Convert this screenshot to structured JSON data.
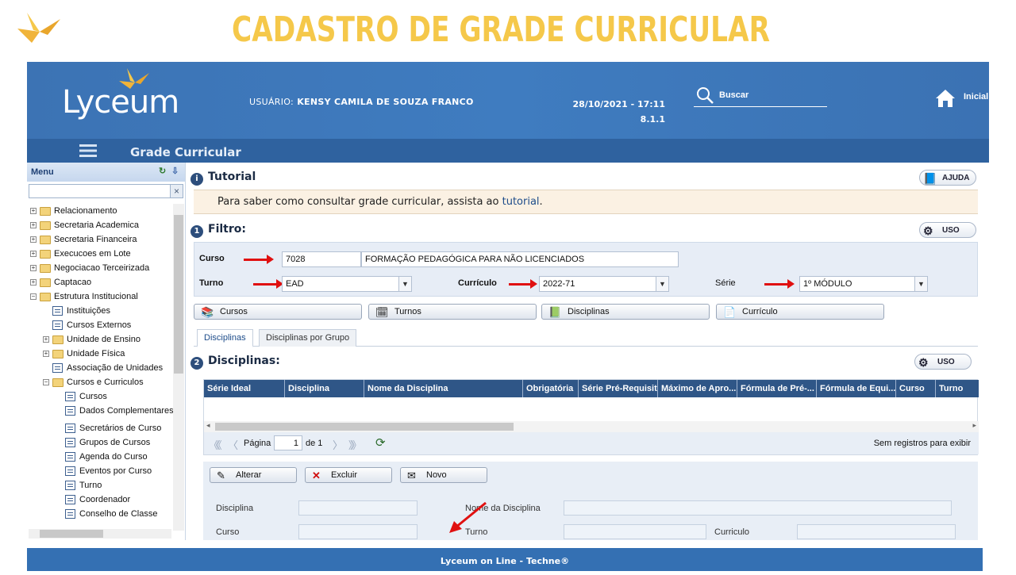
{
  "slide": {
    "title": "CADASTRO DE GRADE CURRICULAR"
  },
  "colors": {
    "title_yellow": "#f5c84a",
    "header_blue": "#3c73b4",
    "grid_header": "#2f5687",
    "arrow_red": "#e01010"
  },
  "header": {
    "logo": "Lyceum",
    "user_label": "USUÁRIO:",
    "user_name": "KENSY CAMILA DE SOUZA FRANCO",
    "datetime": "28/10/2021 - 17:11",
    "version": "8.1.1",
    "search_label": "Buscar",
    "home_label": "Inicial",
    "page_name": "Grade Curricular"
  },
  "sidebar": {
    "menu_label": "Menu",
    "items": [
      {
        "label": "Relacionamento"
      },
      {
        "label": "Secretaria Academica"
      },
      {
        "label": "Secretaria Financeira"
      },
      {
        "label": "Execucoes em Lote"
      },
      {
        "label": "Negociacao Terceirizada"
      },
      {
        "label": "Captacao"
      },
      {
        "label": "Estrutura Institucional"
      },
      {
        "label": "Instituições"
      },
      {
        "label": "Cursos Externos"
      },
      {
        "label": "Unidade de Ensino"
      },
      {
        "label": "Unidade Física"
      },
      {
        "label": "Associação de Unidades"
      },
      {
        "label": "Cursos e Curriculos"
      },
      {
        "label": "Cursos"
      },
      {
        "label": "Dados Complementares"
      },
      {
        "label": "Secretários de Curso"
      },
      {
        "label": "Grupos de Cursos"
      },
      {
        "label": "Agenda do Curso"
      },
      {
        "label": "Eventos por Curso"
      },
      {
        "label": "Turno"
      },
      {
        "label": "Coordenador"
      },
      {
        "label": "Conselho de Classe"
      }
    ]
  },
  "tutorial": {
    "title": "Tutorial",
    "help_label": "AJUDA",
    "text": "Para saber como consultar grade curricular, assista ao",
    "link": "tutorial",
    "end": "."
  },
  "filter": {
    "title": "Filtro:",
    "uso_label": "USO",
    "curso_label": "Curso",
    "curso_code": "7028",
    "curso_name": "FORMAÇÃO PEDAGÓGICA PARA NÃO LICENCIADOS",
    "turno_label": "Turno",
    "turno_value": "EAD",
    "curriculo_label": "Currículo",
    "curriculo_value": "2022-71",
    "serie_label": "Série",
    "serie_value": "1º MÓDULO"
  },
  "buttons": {
    "cursos": "Cursos",
    "turnos": "Turnos",
    "disciplinas": "Disciplinas",
    "curriculo": "Currículo"
  },
  "tabs": [
    {
      "label": "Disciplinas"
    },
    {
      "label": "Disciplinas por Grupo"
    }
  ],
  "disciplinas": {
    "title": "Disciplinas:",
    "uso_label": "USO",
    "columns": [
      "Série Ideal",
      "Disciplina",
      "Nome da Disciplina",
      "Obrigatória",
      "Série Pré-Requisito",
      "Máximo de Apro...",
      "Fórmula de Pré-...",
      "Fórmula de Equi...",
      "Curso",
      "Turno"
    ],
    "pager": {
      "page_label": "Página",
      "page": "1",
      "of_label": "de 1",
      "empty": "Sem registros para exibir"
    }
  },
  "actions": {
    "alterar": "Alterar",
    "excluir": "Excluir",
    "novo": "Novo"
  },
  "form": {
    "disciplina": "Disciplina",
    "nome_disciplina": "Nome da Disciplina",
    "curso": "Curso",
    "turno": "Turno",
    "curriculo": "Curriculo"
  },
  "footer": {
    "text": "Lyceum on Line - Techne®"
  }
}
